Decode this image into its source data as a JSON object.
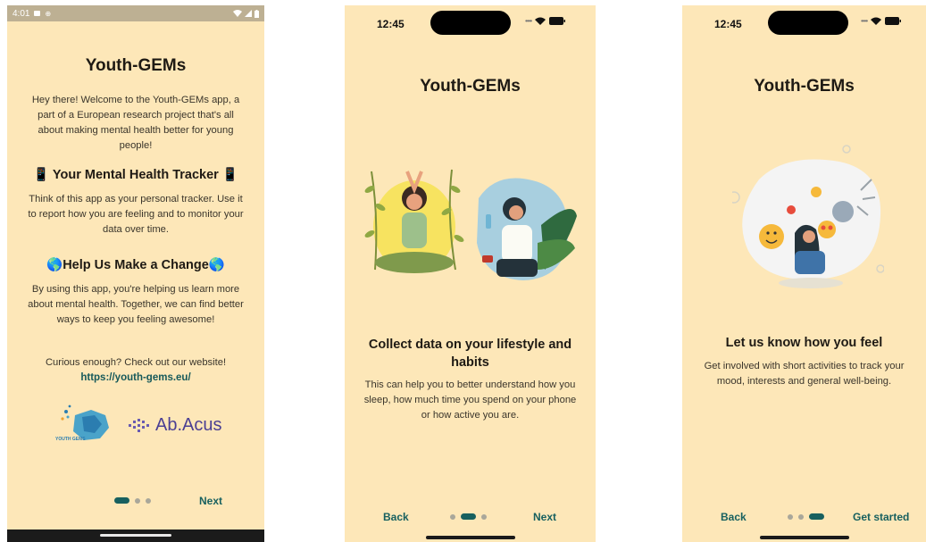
{
  "screen1": {
    "status": {
      "time": "4:01"
    },
    "title": "Youth-GEMs",
    "intro": "Hey there! Welcome to the Youth-GEMs app, a part of a European research project that's all about making mental health better for young people!",
    "tracker_heading": "📱 Your Mental Health Tracker 📱",
    "tracker_text": "Think of this app as your personal tracker. Use it to report how you are feeling and to monitor your data over time.",
    "change_heading": "🌎Help Us Make a Change🌎",
    "change_text": "By using this app, you're helping us learn more about mental health. Together, we can find better ways to keep you feeling awesome!",
    "curious_text": "Curious enough? Check out our website!",
    "website_link": "https://youth-gems.eu/",
    "logo1_text": "YOUTH GEMS",
    "logo2_text": "Ab.Acus",
    "next_label": "Next",
    "page_index": 1,
    "page_count": 3
  },
  "screen2": {
    "status": {
      "time": "12:45"
    },
    "title": "Youth-GEMs",
    "heading": "Collect data on your lifestyle and habits",
    "text": "This can help you to better understand how you sleep, how much time you spend on your phone or how active you are.",
    "back_label": "Back",
    "next_label": "Next",
    "page_index": 2,
    "page_count": 3
  },
  "screen3": {
    "status": {
      "time": "12:45"
    },
    "title": "Youth-GEMs",
    "heading": "Let us know how you feel",
    "text": "Get involved with short activities to track your mood, interests and general well-being.",
    "back_label": "Back",
    "start_label": "Get started",
    "page_index": 3,
    "page_count": 3
  },
  "colors": {
    "background": "#fde7b8",
    "accent": "#17605f",
    "link": "#16595a",
    "dot_inactive": "#a9a79a"
  },
  "icons": [
    "message-icon",
    "location-icon",
    "wifi-icon",
    "signal-icon",
    "battery-icon",
    "phone-emoji-icon",
    "globe-emoji-icon"
  ]
}
